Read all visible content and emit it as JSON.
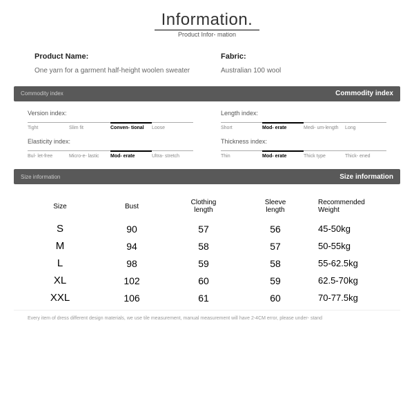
{
  "header": {
    "title": "Information.",
    "subtitle": "Product Infor-\nmation"
  },
  "product": {
    "name_label": "Product Name:",
    "name_value": "One yarn for a garment half-height woolen sweater",
    "fabric_label": "Fabric:",
    "fabric_value": "Australian 100 wool"
  },
  "bars": {
    "commodity_left": "Commodity index",
    "commodity_right": "Commodity index",
    "size_left": "Size information",
    "size_right": "Size information"
  },
  "indexes": [
    {
      "title": "Version index:",
      "options": [
        "Tight",
        "Slim fit",
        "Conven-\ntional",
        "Loose"
      ],
      "selected": 2
    },
    {
      "title": "Length index:",
      "options": [
        "Short",
        "Mod-\nerate",
        "Medi-\num-length",
        "Long"
      ],
      "selected": 1
    },
    {
      "title": "Elasticity index:",
      "options": [
        "Bul-\nlet-free",
        "Micro-e-\nlastic",
        "Mod-\nerate",
        "Ultra-\nstretch"
      ],
      "selected": 2
    },
    {
      "title": "Thickness index:",
      "options": [
        "Thin",
        "Mod-\nerate",
        "Thick\ntype",
        "Thick-\nened"
      ],
      "selected": 1
    }
  ],
  "size_table": {
    "headers": [
      "Size",
      "Bust",
      "Clothing\nlength",
      "Sleeve\nlength",
      "Recommended\nWeight"
    ],
    "rows": [
      [
        "S",
        "90",
        "57",
        "56",
        "45-50kg"
      ],
      [
        "M",
        "94",
        "58",
        "57",
        "50-55kg"
      ],
      [
        "L",
        "98",
        "59",
        "58",
        "55-62.5kg"
      ],
      [
        "XL",
        "102",
        "60",
        "59",
        "62.5-70kg"
      ],
      [
        "XXL",
        "106",
        "61",
        "60",
        "70-77.5kg"
      ]
    ]
  },
  "note": "Every item of dress different design materials, we use tile measurement, manual measurement will have 2-4CM error, please under-\nstand"
}
